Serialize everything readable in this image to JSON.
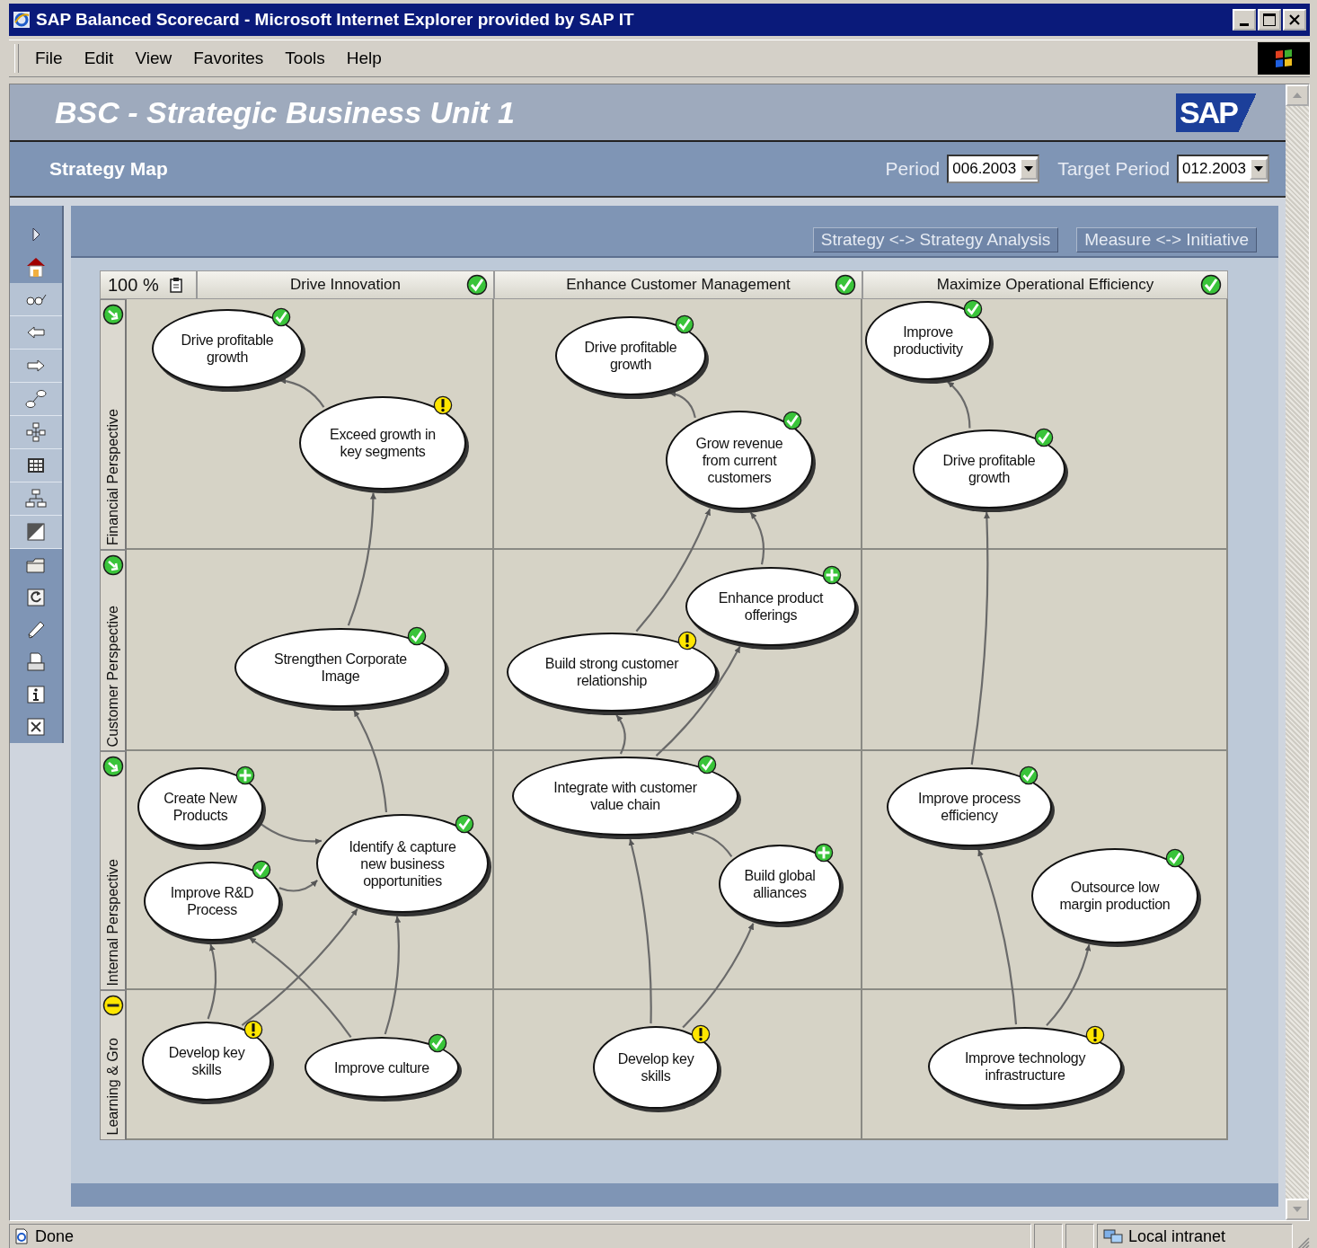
{
  "window": {
    "title": "SAP Balanced Scorecard - Microsoft Internet Explorer provided by SAP IT"
  },
  "menu": [
    "File",
    "Edit",
    "View",
    "Favorites",
    "Tools",
    "Help"
  ],
  "header": {
    "title": "BSC - Strategic Business Unit 1",
    "logo": "SAP"
  },
  "subheader": {
    "title": "Strategy Map",
    "period": {
      "label": "Period",
      "value": "006.2003"
    },
    "target_period": {
      "label": "Target Period",
      "value": "012.2003"
    }
  },
  "view_buttons": [
    "Strategy <-> Strategy Analysis",
    "Measure <-> Initiative"
  ],
  "map": {
    "zoom": "100 %",
    "themes": [
      {
        "name": "Drive Innovation",
        "kind": "check",
        "objectives": [
          {
            "text": "Drive profitable growth",
            "kind": "check"
          },
          {
            "text": "Exceed growth in key segments",
            "kind": "warning"
          },
          {
            "text": "Strengthen Corporate Image",
            "kind": "check"
          },
          {
            "text": "Create New Products",
            "kind": "plus"
          },
          {
            "text": "Identify & capture new business opportunities",
            "kind": "check"
          },
          {
            "text": "Improve R&D Process",
            "kind": "check"
          },
          {
            "text": "Develop key skills",
            "kind": "warning"
          },
          {
            "text": "Improve culture",
            "kind": "check"
          }
        ]
      },
      {
        "name": "Enhance Customer Management",
        "kind": "check",
        "objectives": [
          {
            "text": "Drive profitable growth",
            "kind": "check"
          },
          {
            "text": "Grow revenue from current customers",
            "kind": "check"
          },
          {
            "text": "Enhance product offerings",
            "kind": "plus"
          },
          {
            "text": "Build strong customer relationship",
            "kind": "warning"
          },
          {
            "text": "Integrate with customer value chain",
            "kind": "check"
          },
          {
            "text": "Build global alliances",
            "kind": "plus"
          },
          {
            "text": "Develop key skills",
            "kind": "warning"
          }
        ]
      },
      {
        "name": "Maximize Operational Efficiency",
        "kind": "check",
        "objectives": [
          {
            "text": "Improve productivity",
            "kind": "check"
          },
          {
            "text": "Drive profitable growth",
            "kind": "check"
          },
          {
            "text": "Improve process efficiency",
            "kind": "check"
          },
          {
            "text": "Outsource low margin production",
            "kind": "check"
          },
          {
            "text": "Improve technology infrastructure",
            "kind": "warning"
          }
        ]
      }
    ],
    "perspectives": [
      {
        "name": "Financial Perspective",
        "kind": "trend"
      },
      {
        "name": "Customer Perspective",
        "kind": "trend"
      },
      {
        "name": "Internal Perspective",
        "kind": "trend"
      },
      {
        "name": "Learning & Gro",
        "kind": "warning"
      }
    ]
  },
  "status_bar": {
    "text": "Done",
    "zone": "Local intranet"
  }
}
